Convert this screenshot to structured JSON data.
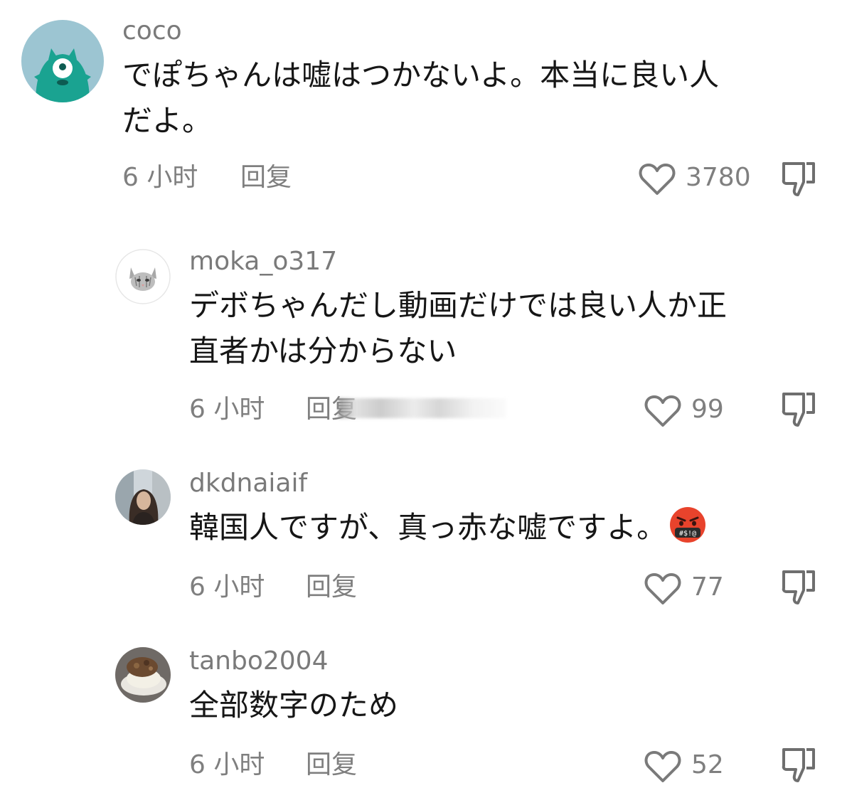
{
  "comments": [
    {
      "username": "coco",
      "text_lines": [
        "でぽちゃんは嘘はつかないよ。本当に良い人",
        "だよ。"
      ],
      "time": "6 小时",
      "reply": "回复",
      "likes": "3780",
      "avatar": "teal-monster-avatar"
    },
    {
      "username": "moka_o317",
      "text_lines": [
        "デボちゃんだし動画だけでは良い人か正",
        "直者かは分からない"
      ],
      "time": "6 小时",
      "reply": "回复",
      "likes": "99",
      "avatar": "cat-avatar"
    },
    {
      "username": "dkdnaiaif",
      "text_lines": [
        "韓国人ですが、真っ赤な嘘ですよ。"
      ],
      "emoji": "angry-cursing-face-emoji",
      "time": "6 小时",
      "reply": "回复",
      "likes": "77",
      "avatar": "girl-photo-avatar"
    },
    {
      "username": "tanbo2004",
      "text_lines": [
        "全部数字のため"
      ],
      "time": "6 小时",
      "reply": "回复",
      "likes": "52",
      "avatar": "food-photo-avatar"
    }
  ],
  "icons": {
    "like": "heart-outline-icon",
    "dislike": "thumbs-down-icon"
  },
  "colors": {
    "meta_text": "#7f7f7f",
    "username": "#7a7a7a",
    "avatar_teal": "#1aa391",
    "avatar_bg": "#9cc5d2",
    "emoji_red": "#e8432c"
  }
}
